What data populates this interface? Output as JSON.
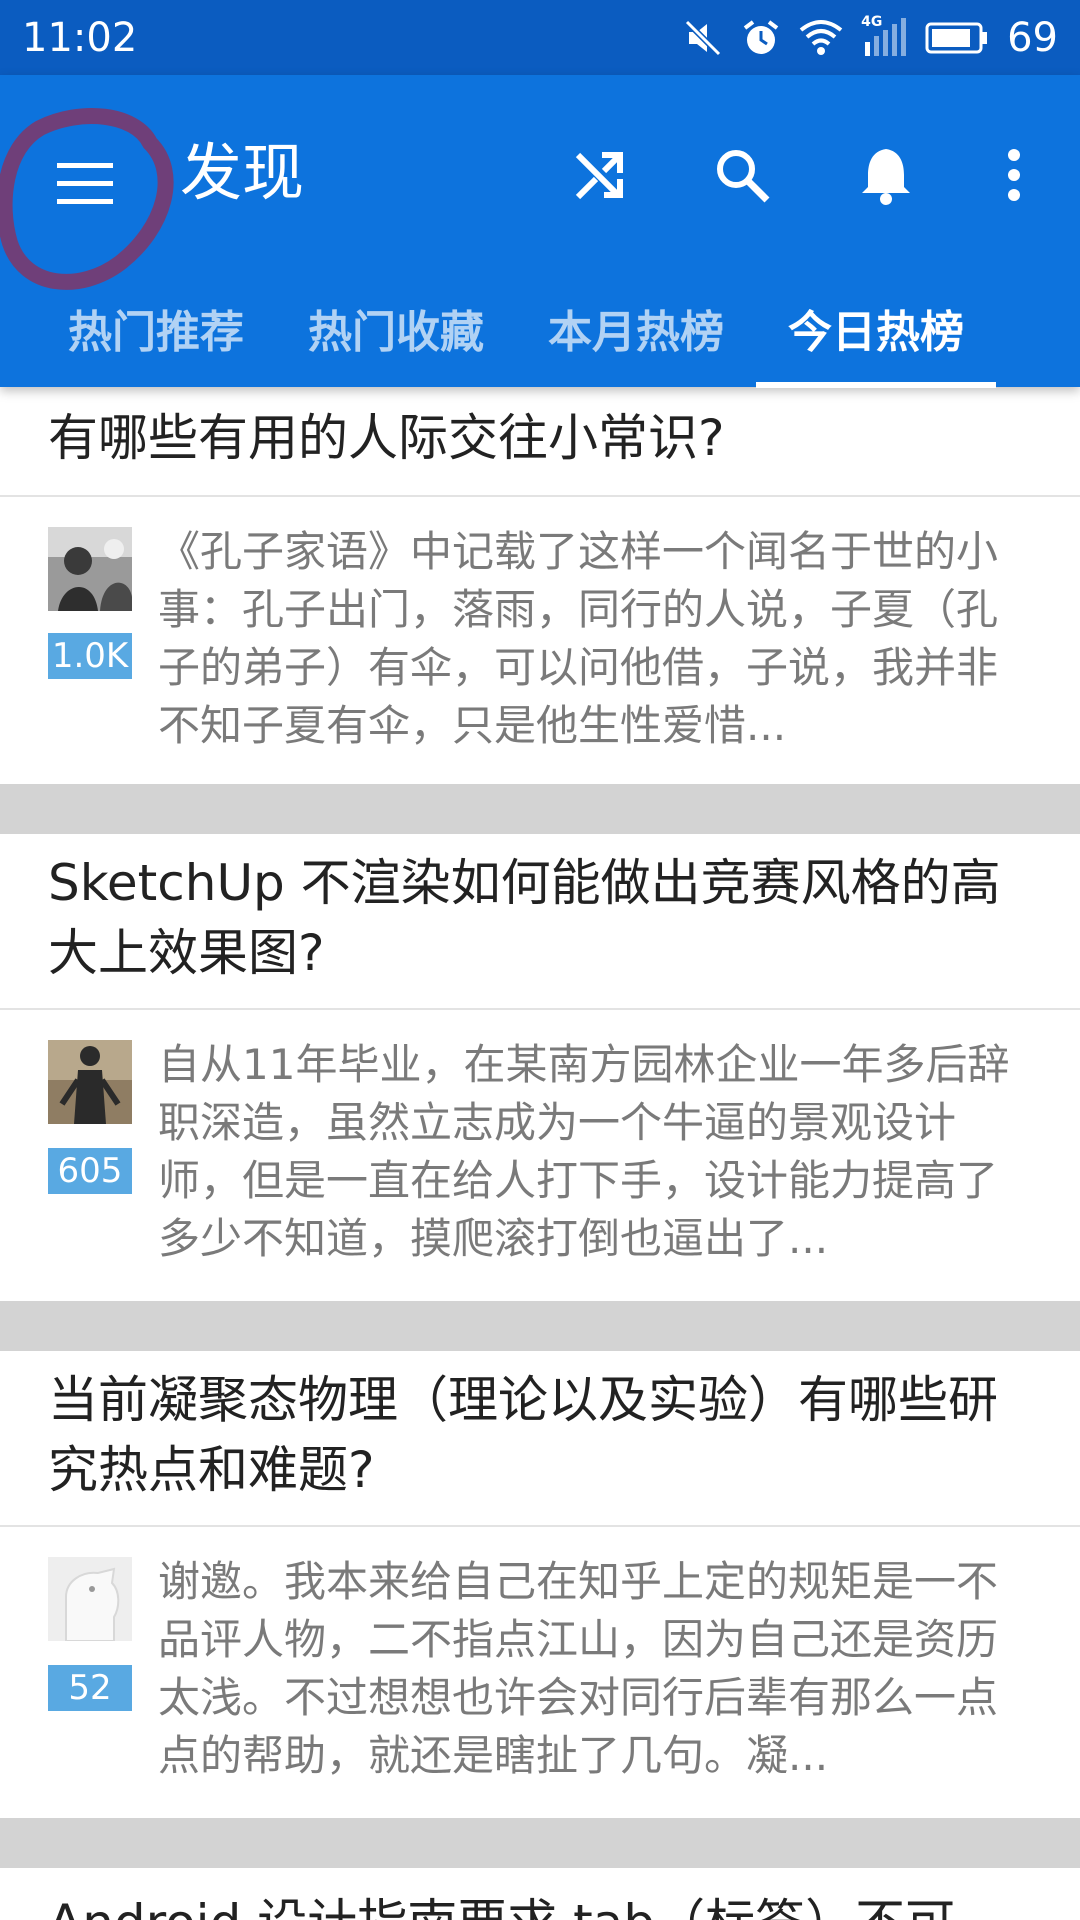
{
  "status_bar": {
    "time": "11:02",
    "network": "4G",
    "battery": "69",
    "icons": [
      "mute-icon",
      "alarm-icon",
      "wifi-icon",
      "signal-icon",
      "battery-icon"
    ]
  },
  "app_bar": {
    "title": "发现",
    "menu_icon": "menu-icon",
    "actions": [
      "shuffle-icon",
      "search-icon",
      "bell-icon",
      "more-vert-icon"
    ],
    "color": "#0d73dd"
  },
  "tabs": [
    {
      "label": "热门推荐",
      "active": false
    },
    {
      "label": "热门收藏",
      "active": false
    },
    {
      "label": "本月热榜",
      "active": false
    },
    {
      "label": "今日热榜",
      "active": true
    }
  ],
  "feed": {
    "items": [
      {
        "title": "有哪些有用的人际交往小常识?",
        "votes": "1.0K",
        "excerpt": "《孔子家语》中记载了这样一个闻名于世的小事：孔子出门，落雨，同行的人说，子夏（孔子的弟子）有伞，可以问他借，子说，我并非不知子夏有伞，只是他生性爱惜..."
      },
      {
        "title": "SketchUp 不渲染如何能做出竞赛风格的高大上效果图?",
        "votes": "605",
        "excerpt": "自从11年毕业，在某南方园林企业一年多后辞职深造，虽然立志成为一个牛逼的景观设计师，但是一直在给人打下手，设计能力提高了多少不知道，摸爬滚打倒也逼出了..."
      },
      {
        "title": "当前凝聚态物理（理论以及实验）有哪些研究热点和难题?",
        "votes": "52",
        "excerpt": "谢邀。我本来给自己在知乎上定的规矩是一不品评人物，二不指点江山，因为自己还是资历太浅。不过想想也许会对同行后辈有那么一点点的帮助，就还是瞎扯了几句。凝..."
      },
      {
        "title": "Android 设计指南要求 tab（标签）不可"
      }
    ]
  },
  "colors": {
    "status_bar": "#0b5cc0",
    "vote_badge": "#59a9e2",
    "separator": "#d3d3d3",
    "annotation_circle": "#7a3a6e"
  }
}
